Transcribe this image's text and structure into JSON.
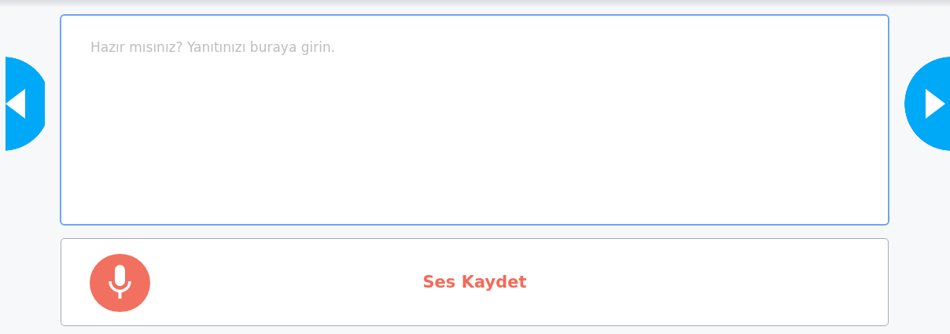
{
  "answer_field": {
    "placeholder": "Hazır mısınız? Yanıtınızı buraya girin."
  },
  "record_button": {
    "label": "Ses Kaydet"
  }
}
